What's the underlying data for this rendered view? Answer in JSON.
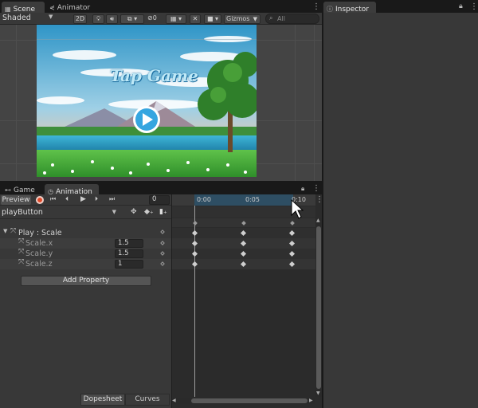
{
  "scene_panel": {
    "tabs": [
      {
        "label": "Scene",
        "icon": "scene-grid-icon"
      },
      {
        "label": "Animator",
        "icon": "animator-icon"
      }
    ],
    "shading_mode": "Shaded",
    "btn_2d": "2D",
    "hidden_count": "0",
    "gizmos": "Gizmos",
    "search_placeholder": "All",
    "game_title_text": "Tap Game"
  },
  "inspector": {
    "tab_label": "Inspector",
    "icon": "info-icon"
  },
  "animation_panel": {
    "tabs": [
      {
        "label": "Game",
        "icon": "gamepad-icon"
      },
      {
        "label": "Animation",
        "icon": "clock-icon"
      }
    ],
    "preview_label": "Preview",
    "frame_value": "0",
    "clip_name": "playButton",
    "timeline_ticks": [
      "0:00",
      "0:05",
      "0:10"
    ],
    "properties": [
      {
        "label": "Play : Scale",
        "value": "",
        "group": true
      },
      {
        "label": "Scale.x",
        "value": "1.5",
        "group": false
      },
      {
        "label": "Scale.y",
        "value": "1.5",
        "group": false
      },
      {
        "label": "Scale.z",
        "value": "1",
        "group": false
      }
    ],
    "add_property_label": "Add Property",
    "bottom_tabs": [
      "Dopesheet",
      "Curves"
    ]
  },
  "colors": {
    "accent_blue": "#3a79bb",
    "record_red": "#e04a2a",
    "panel_bg": "#383838",
    "dark_bg": "#191919"
  }
}
